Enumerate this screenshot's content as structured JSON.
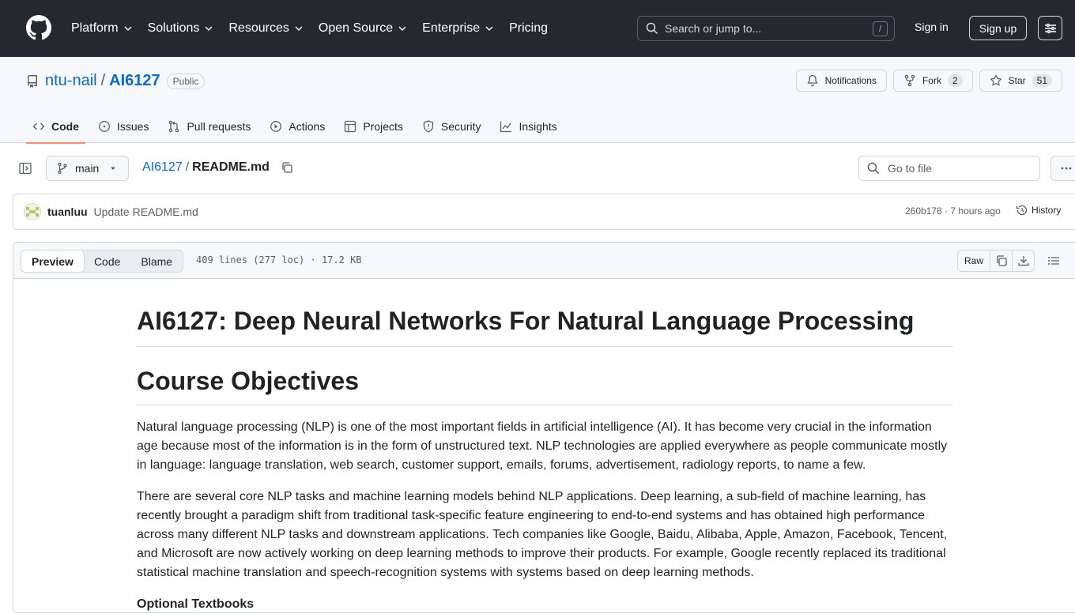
{
  "header": {
    "nav": [
      "Platform",
      "Solutions",
      "Resources",
      "Open Source",
      "Enterprise",
      "Pricing"
    ],
    "search_placeholder": "Search or jump to...",
    "search_shortcut": "/",
    "sign_in": "Sign in",
    "sign_up": "Sign up"
  },
  "repo": {
    "owner": "ntu-nail",
    "name": "AI6127",
    "visibility": "Public",
    "notifications_label": "Notifications",
    "fork_label": "Fork",
    "fork_count": "2",
    "star_label": "Star",
    "star_count": "51",
    "tabs": [
      "Code",
      "Issues",
      "Pull requests",
      "Actions",
      "Projects",
      "Security",
      "Insights"
    ]
  },
  "filenav": {
    "branch": "main",
    "repo_crumb": "AI6127",
    "file_crumb": "README.md",
    "goto_placeholder": "Go to file"
  },
  "commit": {
    "author": "tuanluu",
    "message": "Update README.md",
    "meta": "260b178 · 7 hours ago",
    "history": "History"
  },
  "file": {
    "view_tabs": [
      "Preview",
      "Code",
      "Blame"
    ],
    "info": "409 lines (277 loc) · 17.2 KB",
    "raw": "Raw"
  },
  "readme": {
    "title": "AI6127: Deep Neural Networks For Natural Language Processing",
    "section1": "Course Objectives",
    "para1": "Natural language processing (NLP) is one of the most important fields in artificial intelligence (AI). It has become very crucial in the information age because most of the information is in the form of unstructured text. NLP technologies are applied everywhere as people communicate mostly in language: language translation, web search, customer support, emails, forums, advertisement, radiology reports, to name a few.",
    "para2": "There are several core NLP tasks and machine learning models behind NLP applications. Deep learning, a sub-field of machine learning, has recently brought a paradigm shift from traditional task-specific feature engineering to end-to-end systems and has obtained high performance across many different NLP tasks and downstream applications. Tech companies like Google, Baidu, Alibaba, Apple, Amazon, Facebook, Tencent, and Microsoft are now actively working on deep learning methods to improve their products. For example, Google recently replaced its traditional statistical machine translation and speech-recognition systems with systems based on deep learning methods.",
    "subheading": "Optional Textbooks"
  },
  "colors": {
    "header_bg": "#24292f",
    "link": "#0969da",
    "active_tab_underline": "#fd8c73"
  }
}
